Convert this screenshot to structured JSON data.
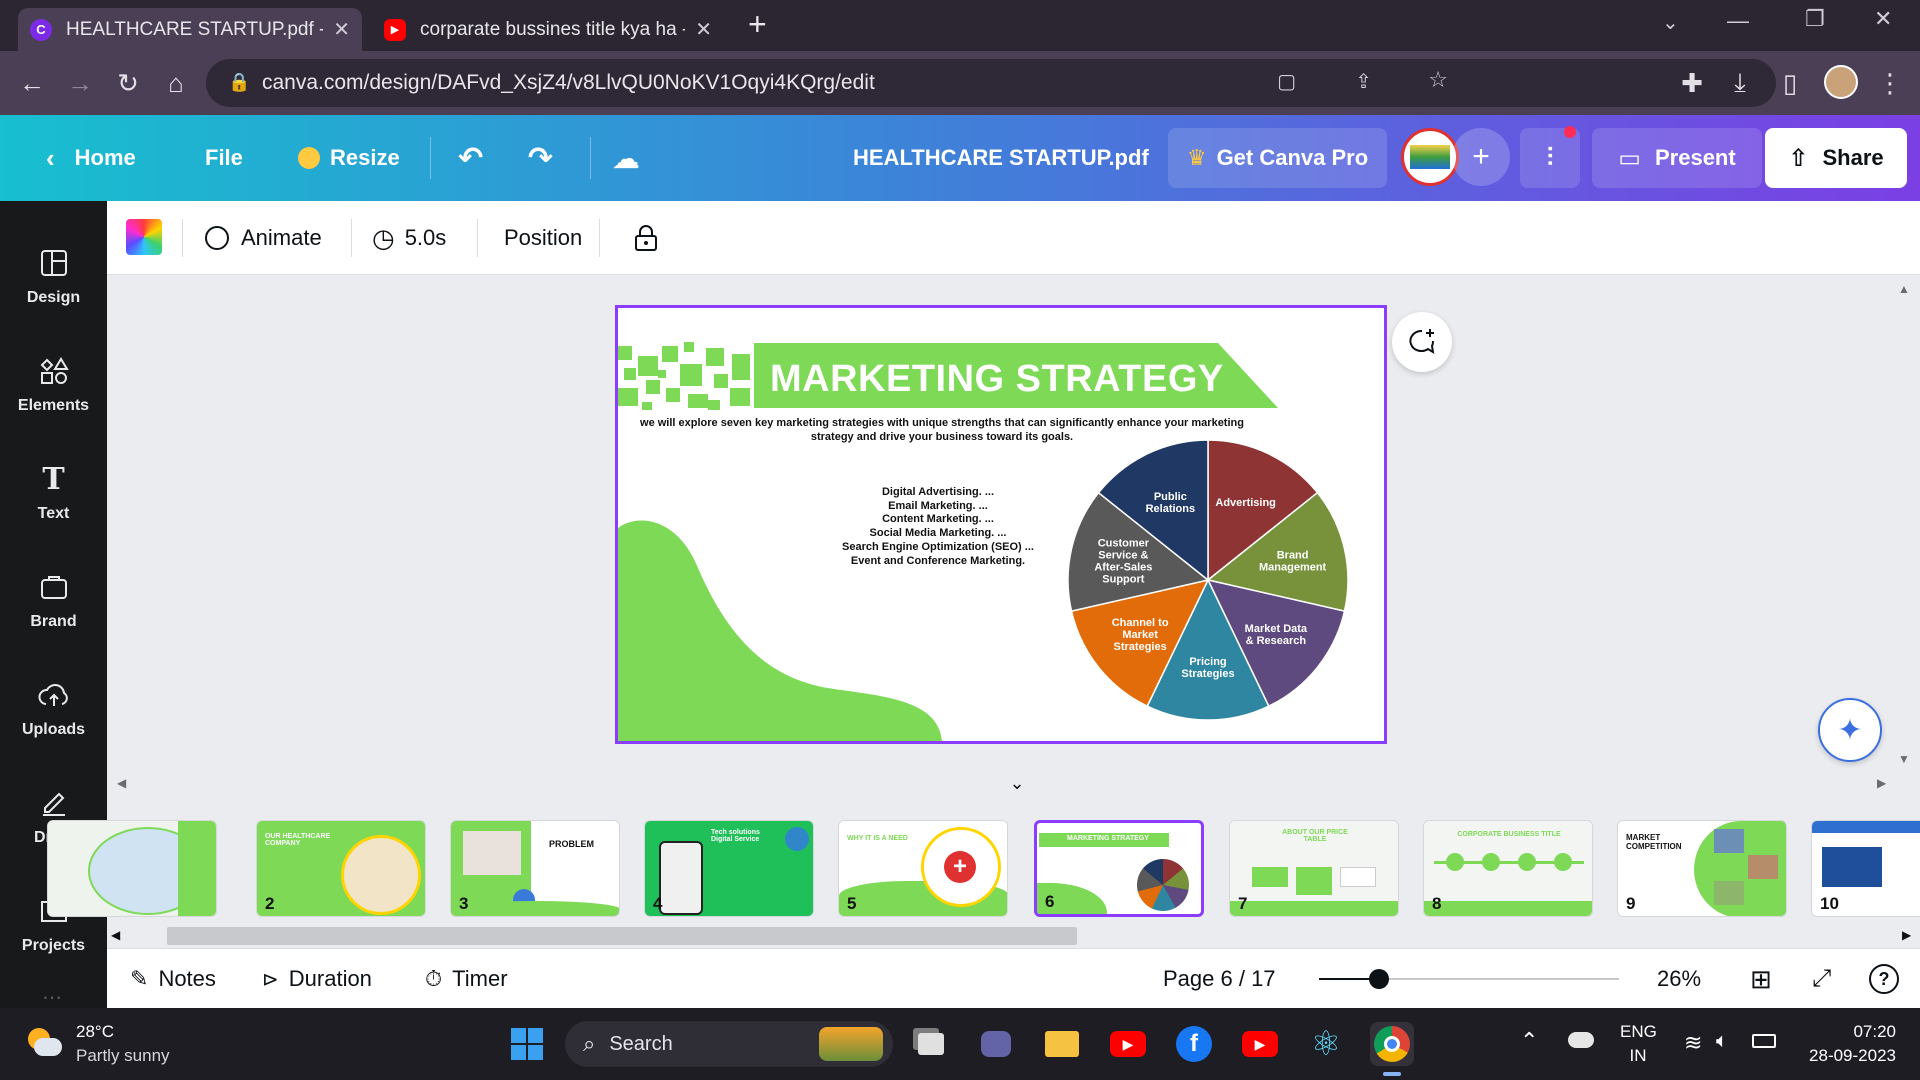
{
  "browser": {
    "tabs": [
      {
        "title": "HEALTHCARE STARTUP.pdf - Pres",
        "favicon": "canva-icon",
        "active": true
      },
      {
        "title": "corparate bussines title kya ha - Y",
        "favicon": "youtube-icon",
        "active": false
      }
    ],
    "new_tab": "+",
    "url": "canva.com/design/DAFvd_XsjZ4/v8LlvQU0NoKV1Oqyi4KQrg/edit"
  },
  "canva_header": {
    "home": "Home",
    "file": "File",
    "resize": "Resize",
    "doc_title": "HEALTHCARE STARTUP.pdf",
    "get_pro": "Get Canva Pro",
    "present": "Present",
    "share": "Share"
  },
  "sidebar": {
    "items": [
      {
        "label": "Design",
        "icon": "design-icon"
      },
      {
        "label": "Elements",
        "icon": "elements-icon"
      },
      {
        "label": "Text",
        "icon": "text-icon"
      },
      {
        "label": "Brand",
        "icon": "brand-icon"
      },
      {
        "label": "Uploads",
        "icon": "uploads-icon"
      },
      {
        "label": "Draw",
        "icon": "draw-icon"
      },
      {
        "label": "Projects",
        "icon": "projects-icon"
      }
    ]
  },
  "toolbar": {
    "animate": "Animate",
    "duration": "5.0s",
    "position": "Position"
  },
  "slide": {
    "title": "MARKETING STRATEGY",
    "intro": "we will explore seven key marketing strategies with unique strengths that can significantly enhance your marketing strategy and drive your business toward its goals.",
    "strategies": [
      "Digital Advertising. ...",
      "Email Marketing. ...",
      "Content Marketing. ...",
      "Social Media Marketing. ...",
      "Search Engine Optimization (SEO) ...",
      "Event and Conference Marketing."
    ],
    "pie": {
      "slices": [
        {
          "label": [
            "Advertising"
          ],
          "color": "#8e3434"
        },
        {
          "label": [
            "Brand",
            "Management"
          ],
          "color": "#77923b"
        },
        {
          "label": [
            "Market Data",
            "& Research"
          ],
          "color": "#5e4a7e"
        },
        {
          "label": [
            "Pricing",
            "Strategies"
          ],
          "color": "#2f86a0"
        },
        {
          "label": [
            "Channel to",
            "Market",
            "Strategies"
          ],
          "color": "#e36c0a"
        },
        {
          "label": [
            "Customer",
            "Service &",
            "After-Sales",
            "Support"
          ],
          "color": "#595959"
        },
        {
          "label": [
            "Public",
            "Relations"
          ],
          "color": "#1f3864"
        }
      ]
    }
  },
  "filmstrip": {
    "pages": [
      {
        "num": "",
        "caption": ""
      },
      {
        "num": "2",
        "caption": "OUR HEALTHCARE COMPANY"
      },
      {
        "num": "3",
        "caption": "PROBLEM"
      },
      {
        "num": "4",
        "caption": "Tech solutions Digital Service"
      },
      {
        "num": "5",
        "caption": "WHY IT IS A NEED"
      },
      {
        "num": "6",
        "caption": "MARKETING STRATEGY"
      },
      {
        "num": "7",
        "caption": "ABOUT OUR PRICE TABLE"
      },
      {
        "num": "8",
        "caption": "CORPORATE BUSINESS TITLE"
      },
      {
        "num": "9",
        "caption": "MARKET COMPETITION"
      },
      {
        "num": "10",
        "caption": ""
      }
    ]
  },
  "bottombar": {
    "notes": "Notes",
    "duration": "Duration",
    "timer": "Timer",
    "page": "Page 6 / 17",
    "zoom_value": 0.26,
    "zoom": "26%"
  },
  "taskbar": {
    "temp": "28°C",
    "weather": "Partly sunny",
    "search": "Search",
    "lang1": "ENG",
    "lang2": "IN",
    "time": "07:20",
    "date": "28-09-2023"
  },
  "colors": {
    "canva_purple": "#8b3dff",
    "slide_green": "#7ed957"
  }
}
